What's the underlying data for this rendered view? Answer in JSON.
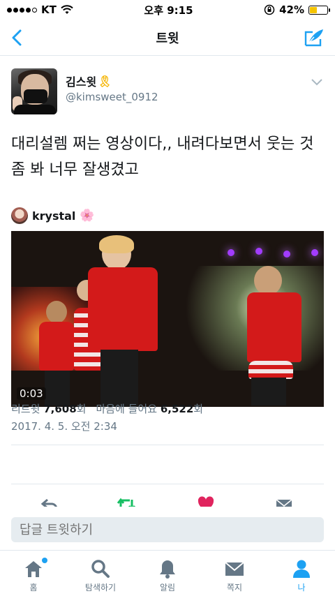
{
  "status_bar": {
    "carrier": "KT",
    "time": "오후 9:15",
    "battery_pct": "42%",
    "battery_level": 0.42
  },
  "nav": {
    "title": "트윗"
  },
  "tweet": {
    "author_name": "김스윗",
    "author_handle": "@kimsweet_0912",
    "text": "대리설렘 쩌는 영상이다,, 내려다보면서 웃는 것 좀 봐 너무 잘생겼고",
    "quoted_author": "krystal",
    "video_duration": "0:03",
    "date": "2017. 4. 5. 오전 2:34",
    "retweets_label": "리트윗",
    "retweets_count": "7,608",
    "retweets_unit": "회",
    "likes_label": "마음에 들어요",
    "likes_count": "6,522",
    "likes_unit": "회"
  },
  "reply": {
    "placeholder": "답글 트윗하기"
  },
  "tabs": [
    {
      "label": "홈",
      "icon": "home-icon"
    },
    {
      "label": "탐색하기",
      "icon": "search-icon"
    },
    {
      "label": "알림",
      "icon": "bell-icon"
    },
    {
      "label": "쪽지",
      "icon": "envelope-icon"
    },
    {
      "label": "나",
      "icon": "person-icon"
    }
  ],
  "colors": {
    "accent": "#1da1f2",
    "like": "#e0245e",
    "retweet": "#17bf63",
    "muted": "#657786"
  }
}
